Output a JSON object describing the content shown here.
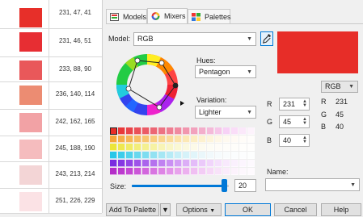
{
  "swatches": [
    {
      "color": "#E72F29",
      "label": "231, 47, 41"
    },
    {
      "color": "#E72E33",
      "label": "231, 46, 51"
    },
    {
      "color": "#E9585A",
      "label": "233, 88, 90"
    },
    {
      "color": "#EC8C72",
      "label": "236, 140, 114"
    },
    {
      "color": "#F2A2A5",
      "label": "242, 162, 165"
    },
    {
      "color": "#F5BCBE",
      "label": "245, 188, 190"
    },
    {
      "color": "#F3D5D6",
      "label": "243, 213, 214"
    },
    {
      "color": "#FBE2E5",
      "label": "251, 226, 229"
    }
  ],
  "tabs": [
    {
      "label": "Models",
      "icon": "models-icon"
    },
    {
      "label": "Mixers",
      "icon": "mixers-icon"
    },
    {
      "label": "Palettes",
      "icon": "palettes-icon"
    }
  ],
  "model": {
    "label": "Model:",
    "value": "RGB"
  },
  "hues": {
    "label": "Hues:",
    "value": "Pentagon"
  },
  "variation": {
    "label": "Variation:",
    "value": "Lighter"
  },
  "preview_color": "#E72D28",
  "right_model": "RGB",
  "rgb_inputs": [
    {
      "label": "R",
      "value": "231"
    },
    {
      "label": "G",
      "value": "45"
    },
    {
      "label": "B",
      "value": "40"
    }
  ],
  "rgb_readout": [
    {
      "label": "R",
      "value": "231"
    },
    {
      "label": "G",
      "value": "45"
    },
    {
      "label": "B",
      "value": "40"
    }
  ],
  "size": {
    "label": "Size:",
    "value": "20"
  },
  "name": {
    "label": "Name:",
    "value": ""
  },
  "buttons": {
    "add": "Add To Palette",
    "options": "Options",
    "ok": "OK",
    "cancel": "Cancel",
    "help": "Help"
  },
  "grid_rows": [
    [
      "#E72D28",
      "#E8393A",
      "#E94449",
      "#EA5058",
      "#EB5B66",
      "#EC6674",
      "#ED7283",
      "#EF7E92",
      "#F08AA0",
      "#F196AE",
      "#F2A2BD",
      "#F3AECB",
      "#F4BAD9",
      "#F6C6E8",
      "#F7D2F6",
      "#FADDF8",
      "#FBE8FA",
      "#FDF3FC"
    ],
    [
      "#F4A53A",
      "#F5AD48",
      "#F6B556",
      "#F7BD63",
      "#F8C571",
      "#F9CD7F",
      "#FAD48D",
      "#FADB9A",
      "#FBE2A8",
      "#FCE8B5",
      "#FCEDC2",
      "#FDF1CF",
      "#FDF4DB",
      "#FEF7E6",
      "#FEF9EF",
      "#FFFAF4",
      "#FFFCF8",
      "#FFFDFB"
    ],
    [
      "#EBE53A",
      "#EEE850",
      "#F0EB66",
      "#F2ED7B",
      "#F4F090",
      "#F6F2A3",
      "#F8F4B5",
      "#F9F6C5",
      "#FAF8D3",
      "#FBF9DF",
      "#FCFAE8",
      "#FDFBEF",
      "#FDFCF4",
      "#FEFCF7",
      "#FEFDF9",
      "#FEFDFA",
      "#FFFEFC",
      "#FFFEFD"
    ],
    [
      "#27C7E8",
      "#3DCDEA",
      "#53D3EC",
      "#69D8EE",
      "#7EDDF0",
      "#93E2F2",
      "#A6E7F4",
      "#B7EBF6",
      "#C7EFF8",
      "#D5F2F9",
      "#E1F5FA",
      "#EAF7FB",
      "#F1F9FC",
      "#F6FBFD",
      "#F9FCFD",
      "#FBFDFE",
      "#FCFDFE",
      "#FDFEFE"
    ],
    [
      "#7A2CE0",
      "#8638E3",
      "#9246E6",
      "#9E54E9",
      "#AA63EC",
      "#B572EE",
      "#C081F1",
      "#CA90F3",
      "#D39FF5",
      "#DCAEF7",
      "#E4BCF9",
      "#EBC9FA",
      "#F1D5FB",
      "#F5E0FC",
      "#F8E9FD",
      "#FAF0FD",
      "#FCF5FE",
      "#FDF9FE"
    ],
    [
      "#B42DC8",
      "#BC3ACE",
      "#C448D3",
      "#CB57D8",
      "#D266DD",
      "#D875E1",
      "#DE84E5",
      "#E394E9",
      "#E8A3EC",
      "#ECB1EF",
      "#F0BFF2",
      "#F3CCF5",
      "#F6D8F7",
      "#F8E2F9",
      "#FAEBFB",
      "#FCF2FC",
      "#FDF7FD",
      "#FEFAFE"
    ]
  ],
  "colors": {
    "accent": "#0078D7",
    "tab_border": "#C8C8C8"
  }
}
